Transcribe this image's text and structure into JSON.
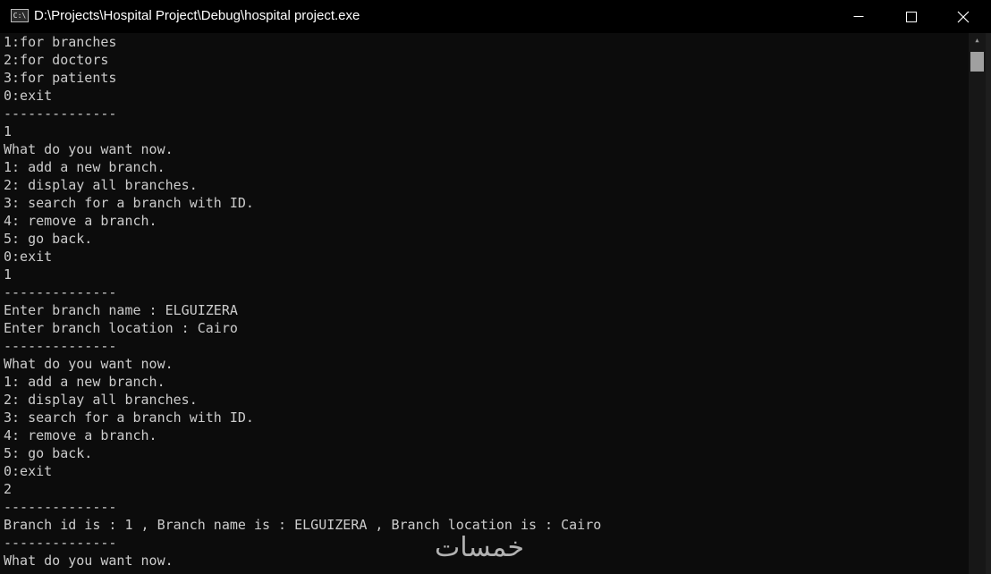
{
  "window": {
    "title": "D:\\Projects\\Hospital Project\\Debug\\hospital project.exe",
    "icon_label": "C:\\"
  },
  "console": {
    "lines": [
      "1:for branches",
      "2:for doctors",
      "3:for patients",
      "0:exit",
      "--------------",
      "1",
      "What do you want now.",
      "1: add a new branch.",
      "2: display all branches.",
      "3: search for a branch with ID.",
      "4: remove a branch.",
      "5: go back.",
      "0:exit",
      "1",
      "--------------",
      "Enter branch name : ELGUIZERA",
      "Enter branch location : Cairo",
      "--------------",
      "What do you want now.",
      "1: add a new branch.",
      "2: display all branches.",
      "3: search for a branch with ID.",
      "4: remove a branch.",
      "5: go back.",
      "0:exit",
      "2",
      "--------------",
      "Branch id is : 1 , Branch name is : ELGUIZERA , Branch location is : Cairo",
      "--------------",
      "What do you want now."
    ]
  },
  "watermark": {
    "text": "خمسات"
  },
  "colors": {
    "text": "#cccccc",
    "background": "#0c0c0c",
    "titlebar": "#000000"
  },
  "icons": [
    "console-app-icon",
    "minimize-icon",
    "maximize-icon",
    "close-icon",
    "scroll-up-arrow-icon"
  ]
}
